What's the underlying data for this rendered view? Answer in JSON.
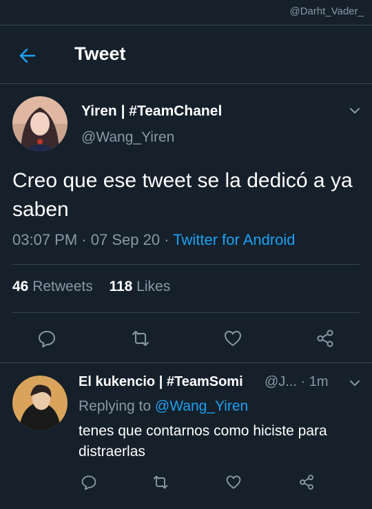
{
  "watermark": "@Darht_Vader_",
  "header": {
    "title": "Tweet"
  },
  "tweet": {
    "author_name": "Yiren | #TeamChanel",
    "author_handle": "@Wang_Yiren",
    "text": "Creo que ese tweet se la dedicó a ya saben",
    "time": "03:07 PM",
    "date": "07 Sep 20",
    "source": "Twitter for Android",
    "retweets_count": "46",
    "retweets_label": "Retweets",
    "likes_count": "118",
    "likes_label": "Likes"
  },
  "reply": {
    "author_name": "El kukencio | #TeamSomi",
    "handle_truncated": "@J...",
    "age": "1m",
    "replying_prefix": "Replying to",
    "replying_to": "@Wang_Yiren",
    "text": "tenes que contarnos como hiciste para distraerlas"
  },
  "colors": {
    "background": "#15202b",
    "accent": "#1da1f2",
    "secondary_text": "#8899a6",
    "divider": "#38444d"
  },
  "icons": [
    "back-arrow-icon",
    "chevron-down-icon",
    "reply-icon",
    "retweet-icon",
    "like-heart-icon",
    "share-icon"
  ]
}
